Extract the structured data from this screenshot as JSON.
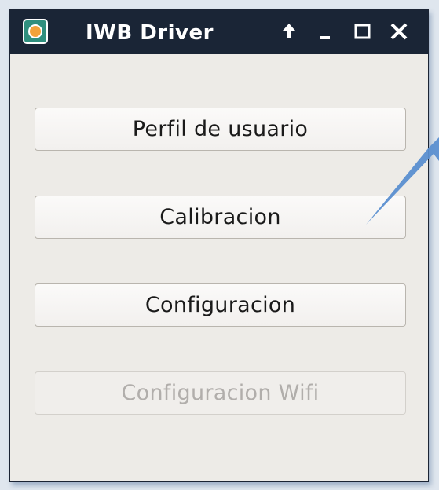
{
  "window": {
    "title": "IWB Driver",
    "controls": {
      "up_icon": "arrow-up-icon",
      "minimize_icon": "minimize-icon",
      "maximize_icon": "maximize-icon",
      "close_icon": "close-icon"
    }
  },
  "buttons": [
    {
      "label": "Perfil de usuario",
      "enabled": true
    },
    {
      "label": "Calibracion",
      "enabled": true
    },
    {
      "label": "Configuracion",
      "enabled": true
    },
    {
      "label": "Configuracion Wifi",
      "enabled": false
    }
  ],
  "colors": {
    "titlebar": "#1a2536",
    "window_bg": "#edebe7",
    "pointer_arrow": "#5b8fd0"
  }
}
